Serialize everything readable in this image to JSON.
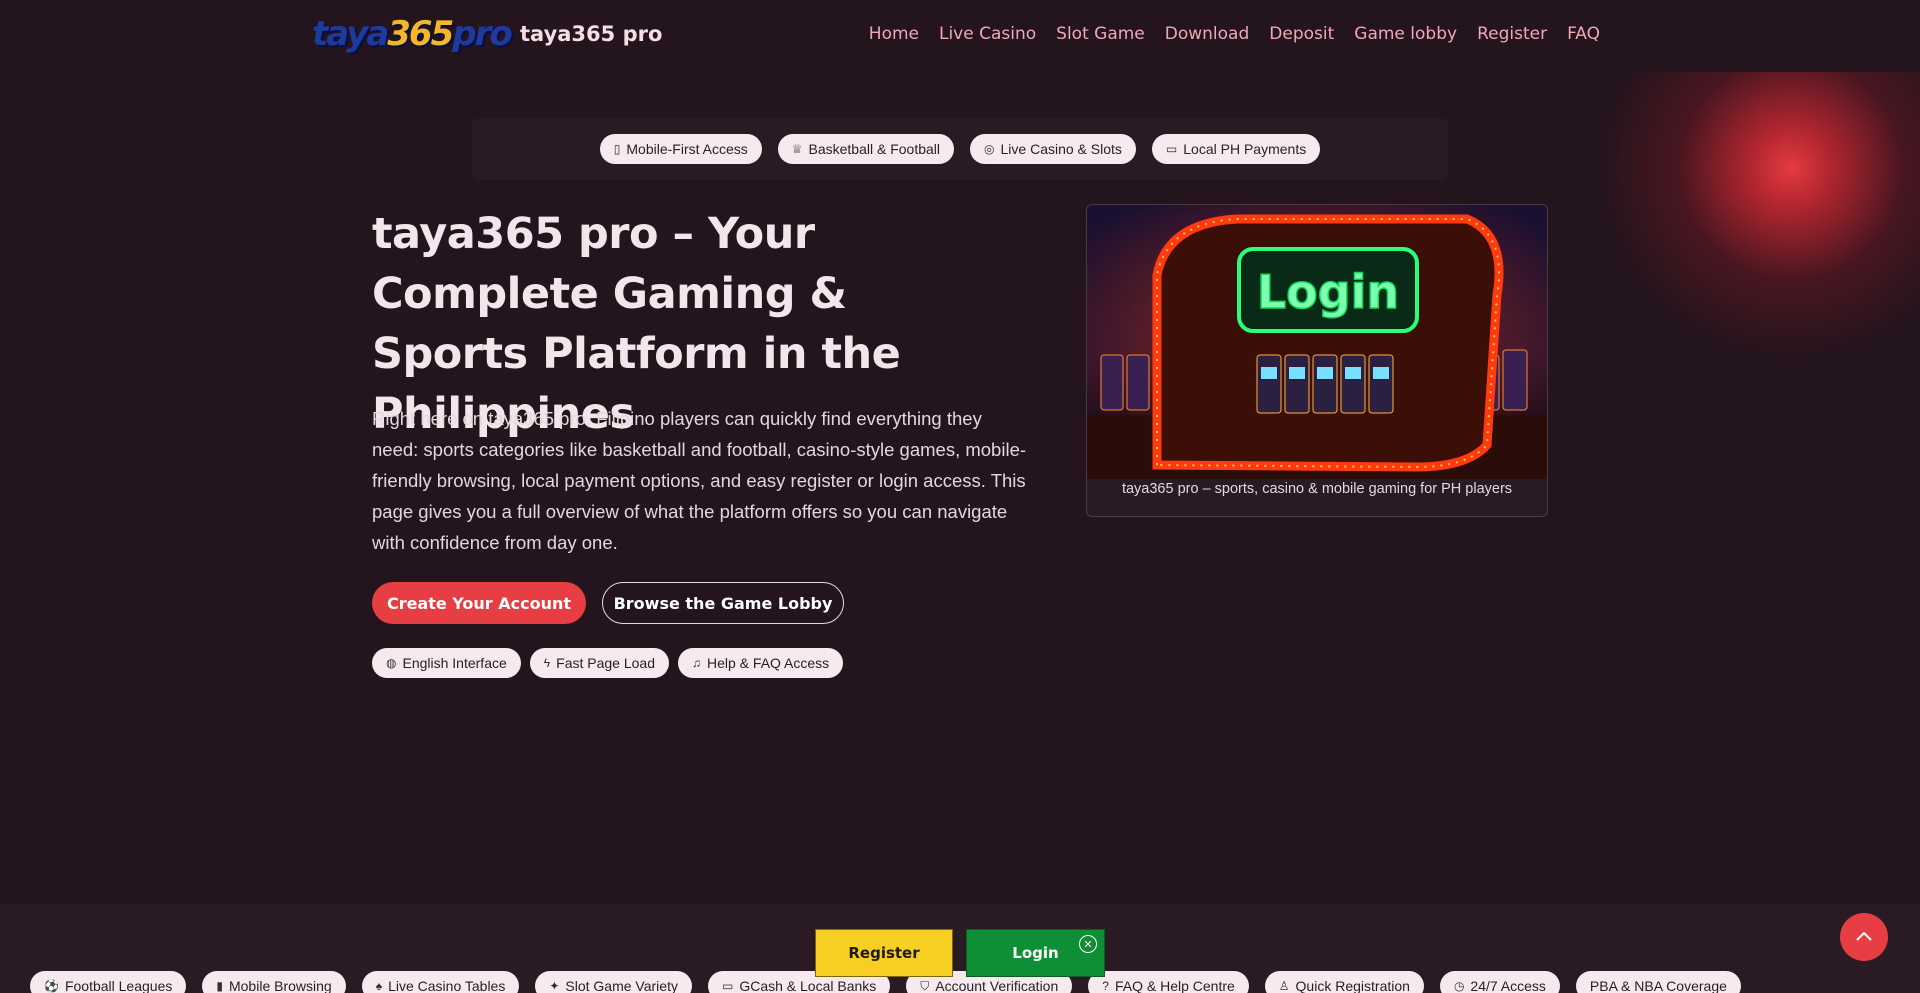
{
  "header": {
    "logo_text": {
      "part1": "taya",
      "part2": "365",
      "part3": "pro"
    },
    "brand": "taya365 pro",
    "nav": [
      "Home",
      "Live Casino",
      "Slot Game",
      "Download",
      "Deposit",
      "Game lobby",
      "Register",
      "FAQ"
    ]
  },
  "top_pills": [
    {
      "label": "Mobile-First Access",
      "icon": "phone-icon",
      "glyph": "▯"
    },
    {
      "label": "Basketball & Football",
      "icon": "trophy-icon",
      "glyph": "♕"
    },
    {
      "label": "Live Casino & Slots",
      "icon": "gamepad-icon",
      "glyph": "◎"
    },
    {
      "label": "Local PH Payments",
      "icon": "card-icon",
      "glyph": "▭"
    }
  ],
  "hero": {
    "title": "taya365 pro – Your Complete Gaming & Sports Platform in the Philippines",
    "text": "Right here on taya365 pro, Filipino players can quickly find everything they need: sports categories like basketball and football, casino-style games, mobile-friendly browsing, local payment options, and easy register or login access. This page gives you a full overview of what the platform offers so you can navigate with confidence from day one.",
    "primary_button": "Create Your Account",
    "secondary_button": "Browse the Game Lobby"
  },
  "feature_pills": [
    {
      "label": "English Interface",
      "icon": "globe-icon",
      "glyph": "◍"
    },
    {
      "label": "Fast Page Load",
      "icon": "bolt-icon",
      "glyph": "ϟ"
    },
    {
      "label": "Help & FAQ Access",
      "icon": "headset-icon",
      "glyph": "♫"
    }
  ],
  "image_card": {
    "image_text": "Login",
    "caption": "taya365 pro – sports, casino & mobile gaming for PH players"
  },
  "marquee": [
    {
      "label": "Football Leagues",
      "icon": "ball-icon",
      "glyph": "⚽"
    },
    {
      "label": "Mobile Browsing",
      "icon": "phone-icon",
      "glyph": "▮"
    },
    {
      "label": "Live Casino Tables",
      "icon": "spade-icon",
      "glyph": "♠"
    },
    {
      "label": "Slot Game Variety",
      "icon": "sparkle-icon",
      "glyph": "✦"
    },
    {
      "label": "GCash & Local Banks",
      "icon": "wallet-icon",
      "glyph": "▭"
    },
    {
      "label": "Account Verification",
      "icon": "shield-icon",
      "glyph": "⛉"
    },
    {
      "label": "FAQ & Help Centre",
      "icon": "question-icon",
      "glyph": "?"
    },
    {
      "label": "Quick Registration",
      "icon": "user-plus-icon",
      "glyph": "♙"
    },
    {
      "label": "24/7 Access",
      "icon": "clock-icon",
      "glyph": "◷"
    },
    {
      "label": "PBA & NBA Coverage",
      "icon": "",
      "glyph": ""
    }
  ],
  "floating_cta": {
    "register": "Register",
    "login": "Login",
    "close_glyph": "✕"
  },
  "colors": {
    "background": "#23141d",
    "accent_red": "#e63e43",
    "register_yellow": "#f6cf22",
    "login_green": "#0e8f35",
    "nav_link": "#f0a7b6"
  }
}
